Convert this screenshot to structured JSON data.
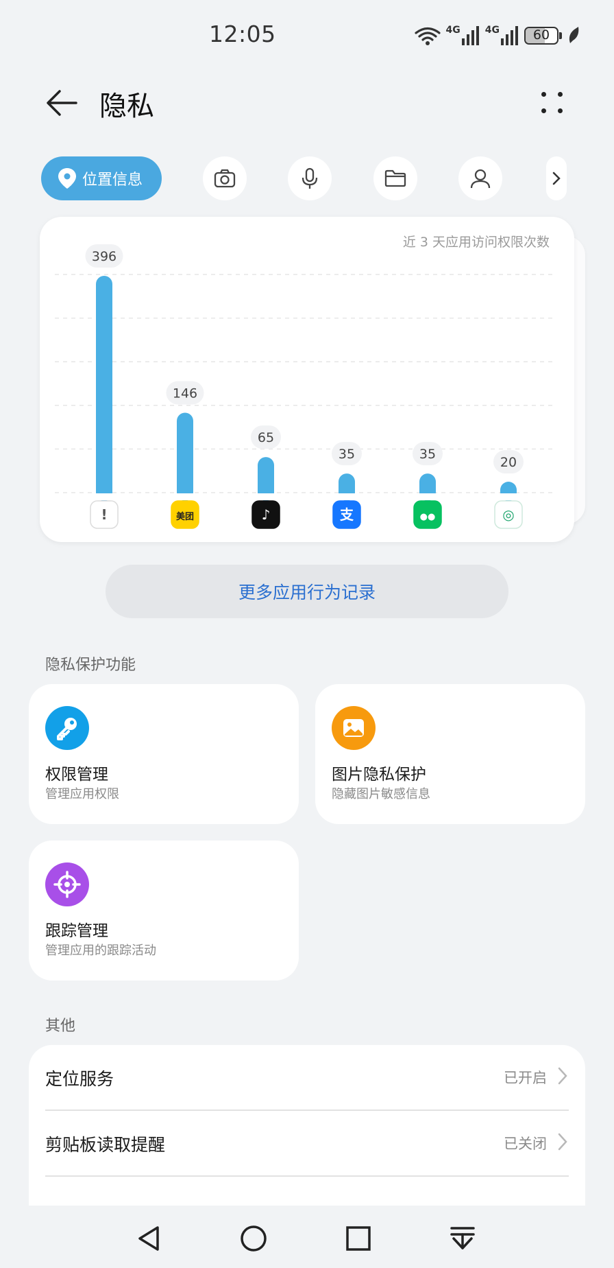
{
  "status_bar": {
    "time": "12:05",
    "network_1": "4G",
    "network_2": "4G",
    "battery": "60",
    "battery_level": 0.6
  },
  "header": {
    "title": "隐私",
    "back_icon": "arrow-left-icon",
    "more_icon": "more-dots-icon"
  },
  "tabs": {
    "active_label": "位置信息",
    "items": [
      "location-pin-icon",
      "camera-icon",
      "microphone-icon",
      "folder-icon",
      "person-icon",
      "chevron-right-icon"
    ]
  },
  "chart_data": {
    "type": "bar",
    "title": "近 3 天应用访问权限次数",
    "categories": [
      "未知应用",
      "美团",
      "抖音",
      "支付宝",
      "微信",
      "绿色应用"
    ],
    "values": [
      396,
      146,
      65,
      35,
      35,
      20
    ],
    "app_icons": [
      "alert-app-icon",
      "meituan-icon",
      "tiktok-icon",
      "alipay-icon",
      "wechat-icon",
      "green-app-icon"
    ],
    "ylim": [
      0,
      396
    ],
    "grid": true,
    "bar_color": "#4ab0e4"
  },
  "more_records": {
    "label": "更多应用行为记录"
  },
  "privacy_section": {
    "label": "隐私保护功能",
    "features": [
      {
        "title": "权限管理",
        "subtitle": "管理应用权限",
        "icon": "key-icon",
        "color": "#12a0e8"
      },
      {
        "title": "图片隐私保护",
        "subtitle": "隐藏图片敏感信息",
        "icon": "image-icon",
        "color": "#f79a0e"
      },
      {
        "title": "跟踪管理",
        "subtitle": "管理应用的跟踪活动",
        "icon": "crosshair-icon",
        "color": "#a84fe8"
      }
    ]
  },
  "others_section": {
    "label": "其他",
    "rows": [
      {
        "label": "定位服务",
        "value": "已开启"
      },
      {
        "label": "剪贴板读取提醒",
        "value": "已关闭"
      }
    ]
  },
  "nav_bar": {
    "icons": [
      "back-triangle-icon",
      "home-circle-icon",
      "recents-square-icon",
      "notification-pull-icon"
    ]
  },
  "colors": {
    "accent": "#4aa8e0",
    "link": "#2a6fd0",
    "background": "#f1f3f5"
  }
}
